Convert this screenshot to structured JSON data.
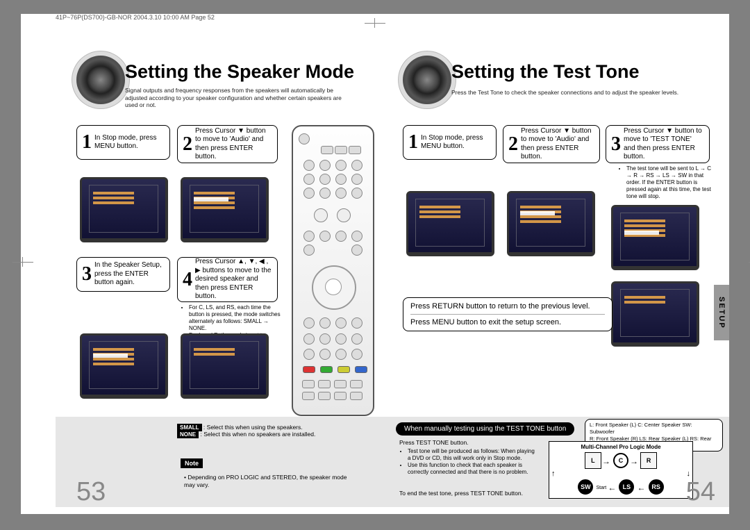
{
  "header": "41P~76P(DS700)-GB-NOR  2004.3.10  10:00 AM  Page 52",
  "left": {
    "title": "Setting the Speaker Mode",
    "subtitle": "Signal outputs and frequency responses from the speakers will automatically be adjusted according to your speaker configuration and whether certain speakers are used or not.",
    "step1": "In Stop mode, press MENU button.",
    "step2": "Press Cursor ▼ button to move to 'Audio' and then press ENTER button.",
    "step3": "In the Speaker Setup, press the ENTER button again.",
    "step4": "Press Cursor ▲, ▼, ◀ , ▶ buttons to move to the desired speaker and then press ENTER button.",
    "bullets4": [
      "For C, LS, and RS, each time the button is pressed, the mode switches alternately as follows: SMALL → NONE.",
      "For L and R, the mode is set to SMALL."
    ],
    "small_label": "SMALL",
    "small_text": " : Select this when using the speakers.",
    "none_label": "NONE",
    "none_text": " : Select this when no speakers are installed.",
    "note_label": "Note",
    "note_text": "Depending on PRO LOGIC and STEREO, the speaker mode may vary.",
    "pagenum": "53"
  },
  "right": {
    "title": "Setting the Test Tone",
    "subtitle": "Press the Test Tone to check the speaker connections and to adjust the speaker levels.",
    "step1": "In Stop mode, press MENU button.",
    "step2": "Press Cursor ▼ button to move to 'Audio' and then press ENTER button.",
    "step3": "Press Cursor ▼ button to move to 'TEST TONE' and then press ENTER button.",
    "bullets3": [
      "The test tone will be sent to L → C → R → RS → LS → SW in that order. If the ENTER button is pressed again at this time, the test tone will stop."
    ],
    "return_text": "Press RETURN button to return to the previous level.",
    "menu_text": "Press MENU button to exit the setup screen.",
    "setup_tab": "SETUP",
    "testtone_pill": "When manually testing using the TEST TONE button",
    "legend": "L: Front Speaker (L)    C: Center Speaker    SW: Subwoofer\nR: Front Speaker (R)   LS: Rear Speaker (L)   RS: Rear Speaker (R)",
    "press_testtone": "Press TEST TONE button.",
    "tt_bullets": [
      "Test tone will be produced as follows: When playing a DVD or CD, this will work only in Stop mode.",
      "Use this function to check that each speaker is correctly connected and that there is no problem."
    ],
    "end_text": "To end the test tone, press TEST TONE button.",
    "diagram_title": "Multi-Channel Pro Logic Mode",
    "diag": {
      "L": "L",
      "C": "C",
      "R": "R",
      "SW": "SW",
      "LS": "LS",
      "RS": "RS",
      "start": "Start"
    },
    "pagenum": "54"
  }
}
